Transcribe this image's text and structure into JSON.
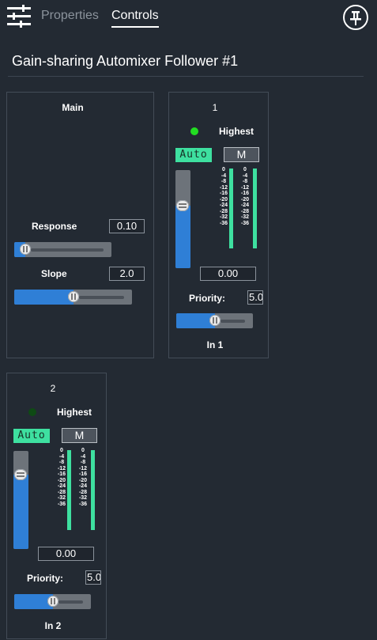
{
  "header": {
    "settings_icon": "sliders-icon",
    "tabs": [
      {
        "label": "Properties",
        "active": false
      },
      {
        "label": "Controls",
        "active": true
      }
    ],
    "pin_icon": "pushpin-icon"
  },
  "title": "Gain-sharing Automixer Follower #1",
  "main": {
    "label": "Main",
    "response": {
      "label": "Response",
      "value": "0.10",
      "level": 0.05
    },
    "slope": {
      "label": "Slope",
      "value": "2.0",
      "level": 0.5
    }
  },
  "channels": [
    {
      "number": "1",
      "status_label": "Highest",
      "led_color": "#22dd22",
      "auto_label": "Auto",
      "mute_label": "M",
      "gain_value": "0.00",
      "gain_level": 0.66,
      "priority_label": "Priority:",
      "priority_value": "5.0",
      "priority_level": 0.5,
      "input_label": "In 1"
    },
    {
      "number": "2",
      "status_label": "Highest",
      "led_color": "#0e4a14",
      "auto_label": "Auto",
      "mute_label": "M",
      "gain_value": "0.00",
      "gain_level": 0.8,
      "priority_label": "Priority:",
      "priority_value": "5.0",
      "priority_level": 0.5,
      "input_label": "In 2"
    }
  ],
  "meter_scale": [
    "0",
    "-4",
    "-8",
    "-12",
    "-16",
    "-20",
    "-24",
    "-28",
    "-32",
    "-36"
  ],
  "colors": {
    "accent": "#3ee0a0",
    "slider_fill": "#2f7fd6",
    "background": "#232a33"
  }
}
